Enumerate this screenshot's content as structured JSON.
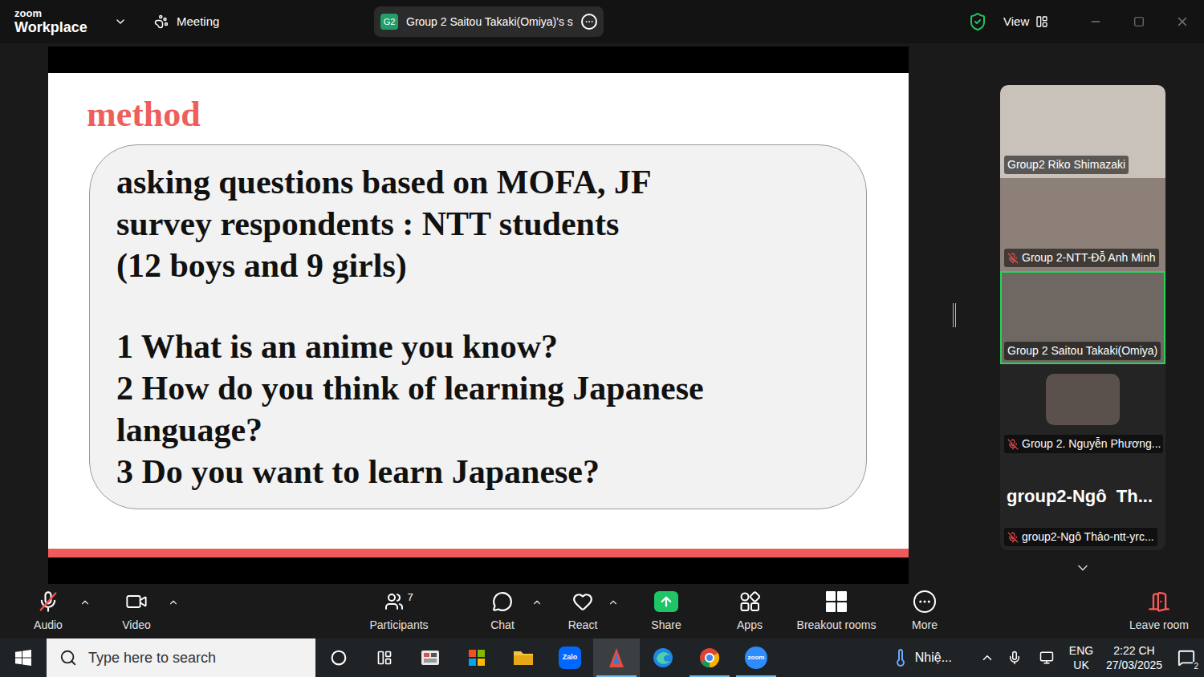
{
  "top_bar": {
    "logo": {
      "top": "zoom",
      "bottom": "Workplace"
    },
    "meeting_label": "Meeting",
    "share_tab": {
      "badge": "G2",
      "title": "Group 2 Saitou Takaki(Omiya)'s s"
    },
    "view_label": "View"
  },
  "slide": {
    "title": "method",
    "intro_lines": [
      "asking questions based on MOFA, JF",
      "survey respondents : NTT students",
      "(12 boys and 9 girls)"
    ],
    "questions": [
      "1 What is an anime you know?",
      "2 How do you think of learning Japanese language?",
      "3 Do you want to learn Japanese?"
    ]
  },
  "participants": [
    {
      "name": "Group2 Riko Shimazaki",
      "muted": false,
      "selected": false,
      "kind": "video"
    },
    {
      "name": "Group 2-NTT-Đỗ Anh Minh",
      "muted": true,
      "selected": false,
      "kind": "video"
    },
    {
      "name": "Group 2 Saitou Takaki(Omiya)",
      "muted": false,
      "selected": true,
      "kind": "video"
    },
    {
      "name": "Group 2. Nguyễn Phương...",
      "muted": true,
      "selected": false,
      "kind": "avatar"
    },
    {
      "name": "group2-Ngô Thảo-ntt-yrc...",
      "display": "group2-Ngô  Th...",
      "muted": true,
      "selected": false,
      "kind": "name"
    }
  ],
  "toolbar": {
    "audio": {
      "label": "Audio",
      "muted": true
    },
    "video": {
      "label": "Video"
    },
    "participants": {
      "label": "Participants",
      "count": "7"
    },
    "chat": {
      "label": "Chat"
    },
    "react": {
      "label": "React"
    },
    "share": {
      "label": "Share"
    },
    "apps": {
      "label": "Apps"
    },
    "breakout": {
      "label": "Breakout rooms"
    },
    "more": {
      "label": "More"
    },
    "leave": {
      "label": "Leave room"
    }
  },
  "taskbar": {
    "search_placeholder": "Type here to search",
    "apps": [
      {
        "label": "",
        "running": false
      },
      {
        "label": "",
        "running": false
      },
      {
        "label": "",
        "running": false
      },
      {
        "label": "Zalo",
        "running": false
      },
      {
        "label": "",
        "running": true
      },
      {
        "label": "",
        "running": false
      },
      {
        "label": "",
        "running": true
      },
      {
        "label": "zoom",
        "running": true
      }
    ],
    "weather": "Nhiệ...",
    "language": [
      "ENG",
      "UK"
    ],
    "time": "2:22 CH",
    "date": "27/03/2025",
    "notifications": "2"
  }
}
